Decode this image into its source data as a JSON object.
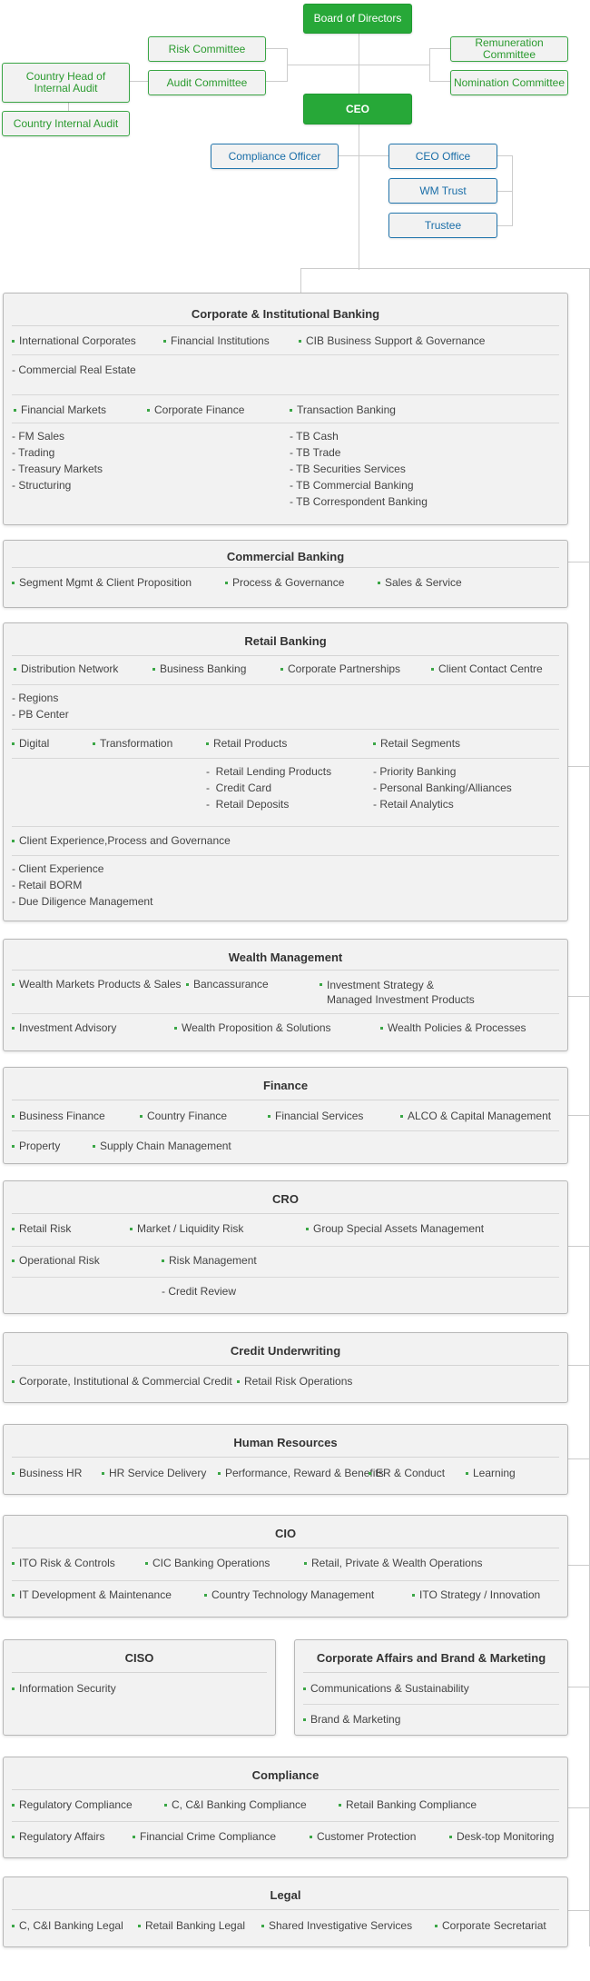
{
  "top": {
    "board": "Board of Directors",
    "risk_committee": "Risk Committee",
    "audit_committee": "Audit Committee",
    "remuneration_committee": "Remuneration Committee",
    "nomination_committee": "Nomination Committee",
    "country_head_internal_audit": "Country Head of Internal Audit",
    "country_internal_audit": "Country Internal Audit",
    "ceo": "CEO",
    "compliance_officer": "Compliance Officer",
    "ceo_office": "CEO Office",
    "wm_trust": "WM Trust",
    "trustee": "Trustee"
  },
  "cib": {
    "title": "Corporate & Institutional Banking",
    "row1": [
      "International Corporates",
      "Financial Institutions",
      "CIB Business Support & Governance"
    ],
    "row1_sub": [
      "- Commercial Real Estate"
    ],
    "row2": [
      "Financial Markets",
      "Corporate Finance",
      "Transaction Banking"
    ],
    "fm_sub": [
      "- FM Sales",
      "- Trading",
      "- Treasury Markets",
      "- Structuring"
    ],
    "tb_sub": [
      "- TB Cash",
      "- TB Trade",
      "- TB Securities Services",
      "- TB Commercial Banking",
      "- TB Correspondent Banking"
    ]
  },
  "commercial": {
    "title": "Commercial Banking",
    "row1": [
      "Segment Mgmt & Client Proposition",
      "Process & Governance",
      "Sales & Service"
    ]
  },
  "retail": {
    "title": "Retail Banking",
    "row1": [
      "Distribution Network",
      "Business Banking",
      "Corporate Partnerships",
      "Client Contact Centre"
    ],
    "dist_sub": [
      "- Regions",
      "- PB Center"
    ],
    "row2": [
      "Digital",
      "Transformation",
      "Retail Products",
      "Retail Segments"
    ],
    "products_sub": [
      "-  Retail Lending Products",
      "-  Credit Card",
      "-  Retail Deposits"
    ],
    "segments_sub": [
      "- Priority Banking",
      "- Personal Banking/Alliances",
      "- Retail Analytics"
    ],
    "row3": [
      "Client Experience,Process and Governance"
    ],
    "cx_sub": [
      "- Client Experience",
      "- Retail BORM",
      "- Due Diligence Management"
    ]
  },
  "wealth": {
    "title": "Wealth Management",
    "row1": [
      "Wealth Markets Products & Sales",
      "Bancassurance",
      "Investment Strategy &\nManaged Investment Products"
    ],
    "row2": [
      "Investment Advisory",
      "Wealth Proposition & Solutions",
      "Wealth Policies & Processes"
    ]
  },
  "finance": {
    "title": "Finance",
    "row1": [
      "Business Finance",
      "Country Finance",
      "Financial Services",
      "ALCO & Capital Management"
    ],
    "row2": [
      "Property",
      "Supply Chain Management"
    ]
  },
  "cro": {
    "title": "CRO",
    "row1": [
      "Retail Risk",
      "Market / Liquidity Risk",
      "Group Special Assets Management"
    ],
    "row2": [
      "Operational Risk",
      "Risk Management"
    ],
    "rm_sub": [
      "- Credit Review"
    ]
  },
  "credit": {
    "title": "Credit Underwriting",
    "row1": [
      "Corporate, Institutional & Commercial Credit",
      "Retail Risk Operations"
    ]
  },
  "hr": {
    "title": "Human Resources",
    "row1": [
      "Business HR",
      "HR Service Delivery",
      "Performance, Reward & Benefits",
      "ER & Conduct",
      "Learning"
    ]
  },
  "cio": {
    "title": "CIO",
    "row1": [
      "ITO Risk & Controls",
      "CIC Banking Operations",
      "Retail, Private & Wealth Operations"
    ],
    "row2": [
      "IT Development & Maintenance",
      "Country Technology Management",
      "ITO Strategy / Innovation"
    ]
  },
  "ciso": {
    "title": "CISO",
    "row1": [
      "Information Security"
    ]
  },
  "corp_affairs": {
    "title": "Corporate Affairs and Brand & Marketing",
    "row1": [
      "Communications & Sustainability"
    ],
    "row2": [
      "Brand & Marketing"
    ]
  },
  "compliance": {
    "title": "Compliance",
    "row1": [
      "Regulatory Compliance",
      "C, C&I Banking Compliance",
      "Retail Banking Compliance"
    ],
    "row2": [
      "Regulatory Affairs",
      "Financial Crime Compliance",
      "Customer Protection",
      "Desk-top Monitoring"
    ]
  },
  "legal": {
    "title": "Legal",
    "row1": [
      "C, C&I Banking Legal",
      "Retail Banking Legal",
      "Shared Investigative Services",
      "Corporate Secretariat"
    ]
  },
  "colors": {
    "brand_green": "#27a838",
    "outline_green": "#2a9a2e",
    "outline_blue": "#1a6ea8",
    "panel_bg": "#f2f2f2"
  }
}
